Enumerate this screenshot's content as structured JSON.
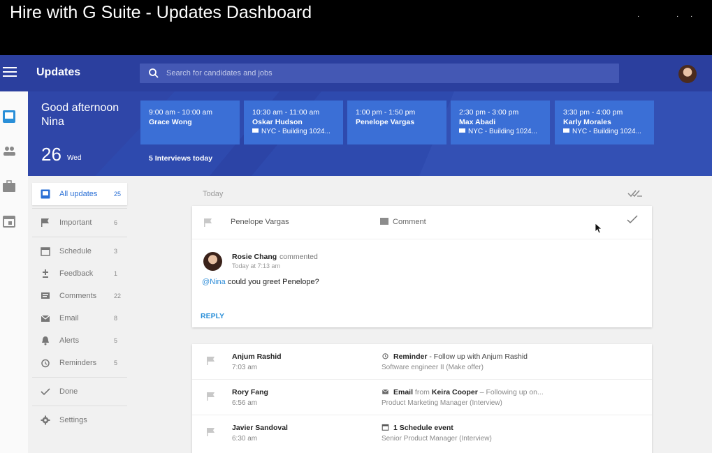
{
  "video": {
    "title": "Hire with G Suite - Updates Dashboard"
  },
  "header": {
    "title": "Updates",
    "search_placeholder": "Search for candidates and jobs"
  },
  "hero": {
    "greeting": "Good afternoon",
    "name": "Nina",
    "date_num": "26",
    "date_day": "Wed",
    "interviews_label": "5  Interviews today",
    "events": [
      {
        "time": "9:00 am - 10:00 am",
        "name": "Grace Wong",
        "location": ""
      },
      {
        "time": "10:30 am - 11:00 am",
        "name": "Oskar Hudson",
        "location": "NYC - Building 1024..."
      },
      {
        "time": "1:00 pm - 1:50 pm",
        "name": "Penelope Vargas",
        "location": ""
      },
      {
        "time": "2:30 pm - 3:00 pm",
        "name": "Max Abadi",
        "location": "NYC - Building 1024..."
      },
      {
        "time": "3:30 pm - 4:00 pm",
        "name": "Karly Morales",
        "location": "NYC - Building 1024..."
      }
    ]
  },
  "filters": [
    {
      "label": "All updates",
      "count": "25",
      "icon": "inbox-icon"
    },
    {
      "label": "Important",
      "count": "6",
      "icon": "flag-icon"
    },
    {
      "label": "Schedule",
      "count": "3",
      "icon": "calendar-icon"
    },
    {
      "label": "Feedback",
      "count": "1",
      "icon": "plus-minus-icon"
    },
    {
      "label": "Comments",
      "count": "22",
      "icon": "comment-icon"
    },
    {
      "label": "Email",
      "count": "8",
      "icon": "mail-icon"
    },
    {
      "label": "Alerts",
      "count": "5",
      "icon": "bell-icon"
    },
    {
      "label": "Reminders",
      "count": "5",
      "icon": "alarm-icon"
    },
    {
      "label": "Done",
      "count": "",
      "icon": "check-icon"
    },
    {
      "label": "Settings",
      "count": "",
      "icon": "gear-icon"
    }
  ],
  "feed": {
    "section_label": "Today",
    "comment_card": {
      "candidate": "Penelope Vargas",
      "type_label": "Comment",
      "author": "Rosie Chang",
      "action": "commented",
      "time": "Today at 7:13 am",
      "mention": "@Nina",
      "message": " could you greet Penelope?",
      "reply_label": "REPLY"
    },
    "rows": [
      {
        "name": "Anjum Rashid",
        "time": "7:03 am",
        "event_bold": "Reminder",
        "event_sep": " - ",
        "event_rest": "Follow up with Anjum Rashid",
        "event_extra": "",
        "sub": "Software engineer II (Make offer)",
        "icon": "alarm-icon"
      },
      {
        "name": "Rory Fang",
        "time": "6:56 am",
        "event_bold": "Email",
        "event_sep": " from ",
        "event_rest": "Keira Cooper",
        "event_extra": " – Following up on...",
        "sub": "Product Marketing Manager (Interview)",
        "icon": "mail-icon"
      },
      {
        "name": "Javier Sandoval",
        "time": "6:30 am",
        "event_bold": "1 Schedule event",
        "event_sep": "",
        "event_rest": "",
        "event_extra": "",
        "sub": "Senior Product Manager (Interview)",
        "icon": "calendar-icon"
      }
    ]
  },
  "colors": {
    "header": "#2b3f9e",
    "hero": "#2f46a8",
    "event_card": "#3b6fd6",
    "accent": "#2a6fd5"
  }
}
